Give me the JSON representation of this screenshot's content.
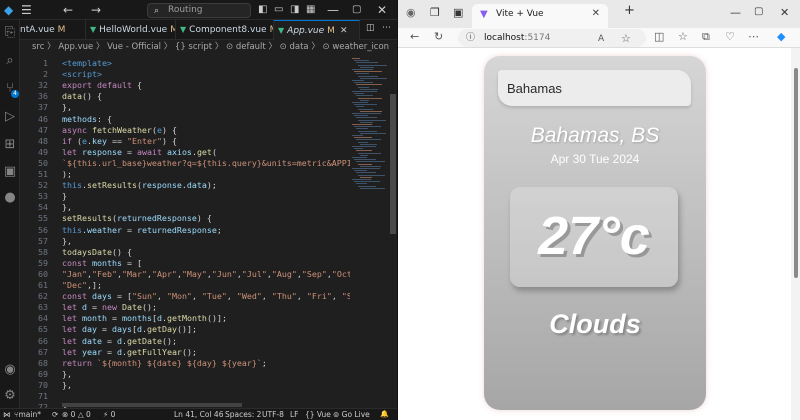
{
  "vscode": {
    "search": "Routing",
    "tabs": [
      {
        "label": "ntA.vue",
        "marker": "M"
      },
      {
        "label": "HelloWorld.vue",
        "marker": "M"
      },
      {
        "label": "Component8.vue",
        "marker": "M"
      },
      {
        "label": "App.vue",
        "marker": "M"
      }
    ],
    "breadcrumb": "src 〉 App.vue 〉 Vue - Official 〉 {} script 〉 ⊙ default 〉 ⊙ data 〉 ⊙ weather_icon",
    "activity_badge": "4",
    "line_numbers": [
      "1",
      "2",
      "32",
      "36",
      "37",
      "46",
      "47",
      "48",
      "49",
      "50",
      "51",
      "52",
      "53",
      "54",
      "55",
      "56",
      "57",
      "58",
      "59",
      "60",
      "61",
      "62",
      "63",
      "64",
      "65",
      "66",
      "67",
      "68",
      "69",
      "70",
      "71",
      "72",
      "73"
    ],
    "code_lines": [
      "<template>",
      "<script>",
      "export default {",
      "data() {",
      "},",
      "methods: {",
      "async fetchWeather(e) {",
      "if (e.key == \"Enter\") {",
      "let response = await axios.get(",
      "`${this.url_base}weather?q=${this.query}&units=metric&APPID=${t",
      ");",
      "this.setResults(response.data);",
      "}",
      "},",
      "setResults(returnedResponse) {",
      "this.weather = returnedResponse;",
      "},",
      "todaysDate() {",
      "const months = [",
      "\"Jan\",\"Feb\",\"Mar\",\"Apr\",\"May\",\"Jun\",\"Jul\",\"Aug\",\"Sep\",\"Oct\",\"No",
      "\"Dec\",];",
      "const days = [\"Sun\", \"Mon\", \"Tue\", \"Wed\", \"Thu\", \"Fri\", \"Sat\"];",
      "let d = new Date();",
      "let month = months[d.getMonth()];",
      "let day = days[d.getDay()];",
      "let date = d.getDate();",
      "let year = d.getFullYear();",
      "return `${month} ${date} ${day} ${year}`;",
      "},",
      "},",
      "",
      "};"
    ],
    "status": {
      "branch": "main*",
      "sync": "⟳",
      "errors": "⊗ 0 △ 0",
      "ports": "⚡ 0",
      "position": "Ln 41, Col 46",
      "spaces": "Spaces: 2",
      "encoding": "UTF-8",
      "eol": "LF",
      "language": "{} Vue",
      "golive": "⊚ Go Live",
      "bell": "🔔"
    }
  },
  "browser": {
    "tab_title": "Vite + Vue",
    "url_host": "localhost",
    "url_port": ":5174"
  },
  "app": {
    "search_value": "Bahamas",
    "city": "Bahamas, BS",
    "date": "Apr 30 Tue 2024",
    "temperature": "27°c",
    "weather": "Clouds"
  }
}
